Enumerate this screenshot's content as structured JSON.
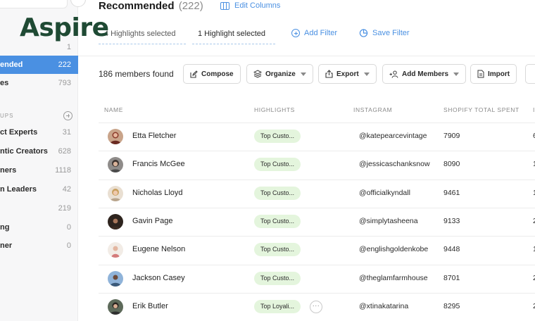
{
  "brand": {
    "logo_text": "Aspire",
    "logo_color": "#1f4a34",
    "accent": "#4a90e2"
  },
  "sidebar": {
    "items_top": [
      {
        "label": "t",
        "count": "1",
        "active": false
      },
      {
        "label": "ended",
        "count": "222",
        "active": true
      },
      {
        "label": "es",
        "count": "793",
        "active": false
      }
    ],
    "groups_header": "UPS",
    "groups": [
      {
        "label": "ct Experts",
        "count": "31"
      },
      {
        "label": "ntic Creators",
        "count": "628"
      },
      {
        "label": "ners",
        "count": "1118"
      },
      {
        "label": "n Leaders",
        "count": "42"
      },
      {
        "label": "",
        "count": "219"
      },
      {
        "label": "ng",
        "count": "0"
      },
      {
        "label": "ner",
        "count": "0"
      }
    ]
  },
  "header": {
    "title": "Recommended",
    "title_count": "(222)",
    "edit_columns": "Edit Columns",
    "highlight_tabs": [
      "4 Highlights selected",
      "1 Highlight selected"
    ],
    "add_filter": "Add Filter",
    "save_filter": "Save Filter"
  },
  "toolbar": {
    "members_found": "186 members found",
    "compose": "Compose",
    "organize": "Organize",
    "export": "Export",
    "add_members": "Add Members",
    "import": "Import"
  },
  "table": {
    "columns": [
      "NAME",
      "HIGHLIGHTS",
      "INSTAGRAM",
      "SHOPIFY TOTAL SPENT",
      "I"
    ],
    "rows": [
      {
        "name": "Etta Fletcher",
        "highlight": "Top Custo...",
        "instagram": "@katepearcevintage",
        "spent": "7909",
        "edge": "6"
      },
      {
        "name": "Francis McGee",
        "highlight": "Top Custo...",
        "instagram": "@jessicaschanksnow",
        "spent": "8090",
        "edge": "1"
      },
      {
        "name": "Nicholas Lloyd",
        "highlight": "Top Custo...",
        "instagram": "@officialkyndall",
        "spent": "9461",
        "edge": "1"
      },
      {
        "name": "Gavin Page",
        "highlight": "Top Custo...",
        "instagram": "@simplytasheena",
        "spent": "9133",
        "edge": "2"
      },
      {
        "name": "Eugene Nelson",
        "highlight": "Top Custo...",
        "instagram": "@englishgoldenkobe",
        "spent": "9448",
        "edge": "1"
      },
      {
        "name": "Jackson Casey",
        "highlight": "Top Custo...",
        "instagram": "@theglamfarmhouse",
        "spent": "8701",
        "edge": "2"
      },
      {
        "name": "Erik Butler",
        "highlight": "Top Loyali...",
        "instagram": "@xtinakatarina",
        "spent": "8295",
        "edge": "2"
      }
    ]
  }
}
